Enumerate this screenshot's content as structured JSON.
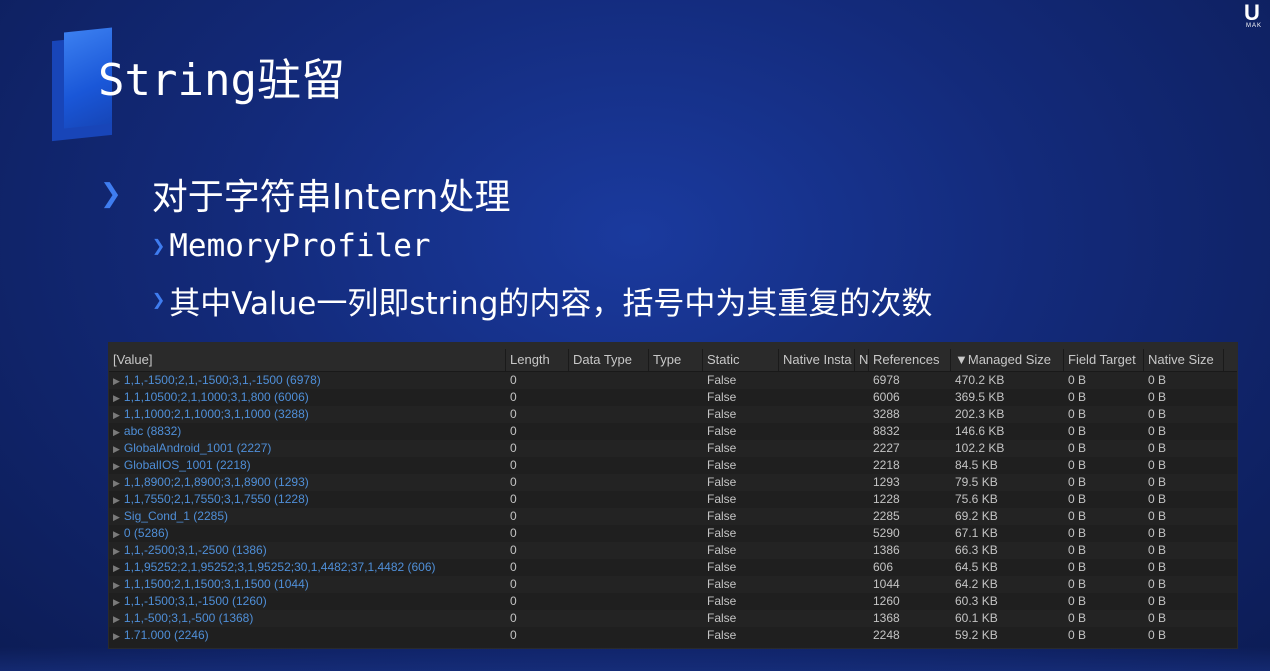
{
  "slide": {
    "title": "String驻留",
    "bullet1": "对于字符串Intern处理",
    "bullet2a": "MemoryProfiler",
    "bullet2b": "其中Value一列即string的内容，括号中为其重复的次数",
    "chevron": "❯",
    "corner_logo_letter": "U",
    "corner_logo_text": "MAK",
    "accent_color": "#3f7df0"
  },
  "profiler": {
    "columns": [
      "[Value]",
      "Length",
      "Data Type",
      "Type",
      "Static",
      "Native Insta",
      "N",
      "References",
      "▼Managed Size",
      "Field Target",
      "Native Size"
    ],
    "rows": [
      {
        "value": "1,1,-1500;2,1,-1500;3,1,-1500 (6978)",
        "length": "0",
        "static": "False",
        "references": "6978",
        "managed": "470.2 KB",
        "field": "0 B",
        "native": "0 B"
      },
      {
        "value": "1,1,10500;2,1,1000;3,1,800 (6006)",
        "length": "0",
        "static": "False",
        "references": "6006",
        "managed": "369.5 KB",
        "field": "0 B",
        "native": "0 B"
      },
      {
        "value": "1,1,1000;2,1,1000;3,1,1000 (3288)",
        "length": "0",
        "static": "False",
        "references": "3288",
        "managed": "202.3 KB",
        "field": "0 B",
        "native": "0 B"
      },
      {
        "value": "abc (8832)",
        "length": "0",
        "static": "False",
        "references": "8832",
        "managed": "146.6 KB",
        "field": "0 B",
        "native": "0 B"
      },
      {
        "value": "GlobalAndroid_1001 (2227)",
        "length": "0",
        "static": "False",
        "references": "2227",
        "managed": "102.2 KB",
        "field": "0 B",
        "native": "0 B"
      },
      {
        "value": "GlobalIOS_1001 (2218)",
        "length": "0",
        "static": "False",
        "references": "2218",
        "managed": "84.5 KB",
        "field": "0 B",
        "native": "0 B"
      },
      {
        "value": "1,1,8900;2,1,8900;3,1,8900 (1293)",
        "length": "0",
        "static": "False",
        "references": "1293",
        "managed": "79.5 KB",
        "field": "0 B",
        "native": "0 B"
      },
      {
        "value": "1,1,7550;2,1,7550;3,1,7550 (1228)",
        "length": "0",
        "static": "False",
        "references": "1228",
        "managed": "75.6 KB",
        "field": "0 B",
        "native": "0 B"
      },
      {
        "value": "Sig_Cond_1 (2285)",
        "length": "0",
        "static": "False",
        "references": "2285",
        "managed": "69.2 KB",
        "field": "0 B",
        "native": "0 B"
      },
      {
        "value": "0 (5286)",
        "length": "0",
        "static": "False",
        "references": "5290",
        "managed": "67.1 KB",
        "field": "0 B",
        "native": "0 B"
      },
      {
        "value": "1,1,-2500;3,1,-2500 (1386)",
        "length": "0",
        "static": "False",
        "references": "1386",
        "managed": "66.3 KB",
        "field": "0 B",
        "native": "0 B"
      },
      {
        "value": "1,1,95252;2,1,95252;3,1,95252;30,1,4482;37,1,4482 (606)",
        "length": "0",
        "static": "False",
        "references": "606",
        "managed": "64.5 KB",
        "field": "0 B",
        "native": "0 B"
      },
      {
        "value": "1,1,1500;2,1,1500;3,1,1500 (1044)",
        "length": "0",
        "static": "False",
        "references": "1044",
        "managed": "64.2 KB",
        "field": "0 B",
        "native": "0 B"
      },
      {
        "value": "1,1,-1500;3,1,-1500 (1260)",
        "length": "0",
        "static": "False",
        "references": "1260",
        "managed": "60.3 KB",
        "field": "0 B",
        "native": "0 B"
      },
      {
        "value": "1,1,-500;3,1,-500 (1368)",
        "length": "0",
        "static": "False",
        "references": "1368",
        "managed": "60.1 KB",
        "field": "0 B",
        "native": "0 B"
      },
      {
        "value": "1.71.000 (2246)",
        "length": "0",
        "static": "False",
        "references": "2248",
        "managed": "59.2 KB",
        "field": "0 B",
        "native": "0 B"
      }
    ]
  }
}
